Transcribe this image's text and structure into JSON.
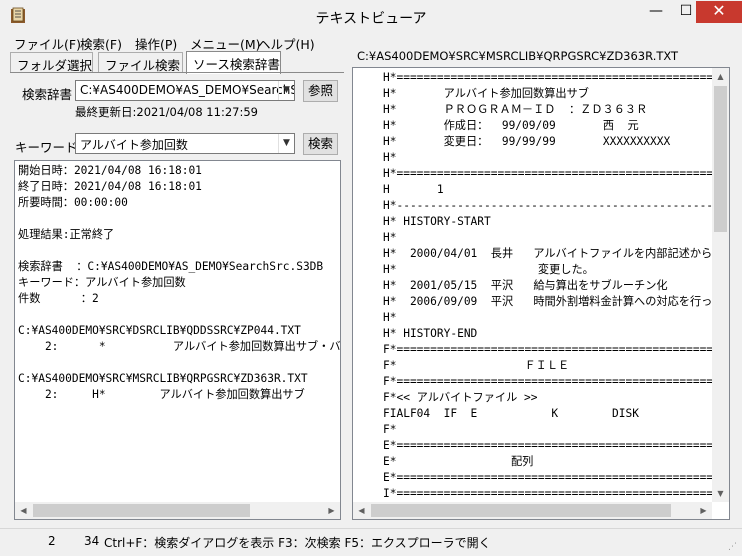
{
  "window": {
    "title": "テキストビューア",
    "min_glyph": "—",
    "max_glyph": "☐",
    "close_glyph": "✕"
  },
  "menu": [
    "ファイル(F)",
    "検索(F)",
    "操作(P)",
    "メニュー(M)",
    "ヘルプ(H)"
  ],
  "tabs": [
    {
      "label": "フォルダ選択",
      "active": false
    },
    {
      "label": "ファイル検索",
      "active": false
    },
    {
      "label": "ソース検索辞書",
      "active": true
    }
  ],
  "search": {
    "dict_label": "検索辞書",
    "dict_value": "C:¥AS400DEMO¥AS_DEMO¥SearchSrc",
    "browse_button": "参照",
    "last_updated": "最終更新日:2021/04/08 11:27:59",
    "keyword_label": "キーワード",
    "keyword_value": "アルバイト参加回数",
    "search_button": "検索"
  },
  "results": [
    "開始日時：2021/04/08 16:18:01",
    "終了日時：2021/04/08 16:18:01",
    "所要時間：00:00:00",
    "",
    "処理結果:正常終了",
    "",
    "検索辞書  ：C:¥AS400DEMO¥AS_DEMO¥SearchSrc.S3DB",
    "キーワード：アルバイト参加回数",
    "件数      ：2",
    "",
    "C:¥AS400DEMO¥SRC¥DSRCLIB¥QDDSSRC¥ZP044.TXT",
    "    2:      *          アルバイト参加回数算出サブ・バ",
    "",
    "C:¥AS400DEMO¥SRC¥MSRCLIB¥QRPGSRC¥ZD363R.TXT",
    "    2:     H*        アルバイト参加回数算出サブ"
  ],
  "viewer": {
    "file_path": "C:¥AS400DEMO¥SRC¥MSRCLIB¥QRPGSRC¥ZD363R.TXT",
    "lines": [
      "H*=================================================",
      "H*       アルバイト参加回数算出サブ",
      "H*       ＰＲＯＧＲＡＭ－ＩＤ  ：ＺＤ３６３Ｒ",
      "H*       作成日：  99/09/09       西  元",
      "H*       変更日：  99/99/99       XXXXXXXXXX",
      "H*",
      "H*=================================================",
      "H       1",
      "H*-------------------------------------------------",
      "H* HISTORY-START",
      "H*",
      "H*  2000/04/01  長井   アルバイトファイルを内部記述から",
      "H*                     変更した。",
      "H*  2001/05/15  平沢   給与算出をサブルーチン化",
      "H*  2006/09/09  平沢   時間外割増料金計算への対応を行っ",
      "H*",
      "H* HISTORY-END",
      "F*=================================================",
      "F*                   ＦＩＬＥ",
      "F*=================================================",
      "F*<< アルバイトファイル >>",
      "FIALF04  IF  E           K        DISK",
      "F*",
      "E*=================================================",
      "E*                 配列",
      "E*=================================================",
      "I*================================================="
    ]
  },
  "status": {
    "line": "2",
    "col": "34",
    "hint": "Ctrl+F：検索ダイアログを表示  F3：次検索  F5：エクスプローラで開く"
  },
  "icons": {
    "app": "book-icon",
    "scroll_up": "▲",
    "scroll_down": "▼",
    "scroll_left": "◀",
    "scroll_right": "▶",
    "dropdown": "▼",
    "grip": "⋰"
  }
}
